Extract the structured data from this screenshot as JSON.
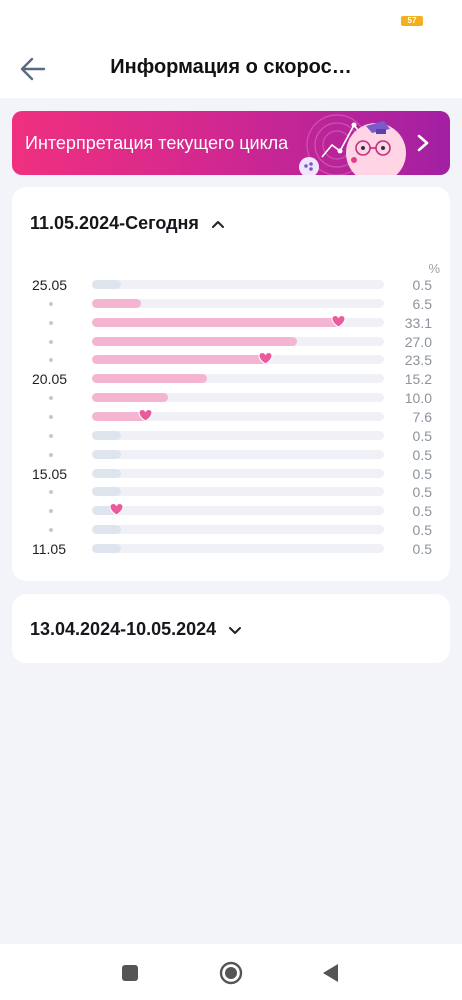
{
  "status_bar": {
    "battery": "57"
  },
  "header": {
    "title": "Информация о скорос…"
  },
  "banner": {
    "label": "Интерпретация текущего цикла"
  },
  "current_range": {
    "label": "11.05.2024-Сегодня",
    "unit": "%",
    "rows": [
      {
        "date": "25.05",
        "value": "0.5",
        "heart": false,
        "highlight": false
      },
      {
        "date": "",
        "value": "6.5",
        "heart": false,
        "highlight": true
      },
      {
        "date": "",
        "value": "33.1",
        "heart": true,
        "highlight": true
      },
      {
        "date": "",
        "value": "27.0",
        "heart": false,
        "highlight": true
      },
      {
        "date": "",
        "value": "23.5",
        "heart": true,
        "highlight": true
      },
      {
        "date": "20.05",
        "value": "15.2",
        "heart": false,
        "highlight": true
      },
      {
        "date": "",
        "value": "10.0",
        "heart": false,
        "highlight": true
      },
      {
        "date": "",
        "value": "7.6",
        "heart": true,
        "highlight": true
      },
      {
        "date": "",
        "value": "0.5",
        "heart": false,
        "highlight": false
      },
      {
        "date": "",
        "value": "0.5",
        "heart": false,
        "highlight": false
      },
      {
        "date": "15.05",
        "value": "0.5",
        "heart": false,
        "highlight": false
      },
      {
        "date": "",
        "value": "0.5",
        "heart": false,
        "highlight": false
      },
      {
        "date": "",
        "value": "0.5",
        "heart": true,
        "highlight": false
      },
      {
        "date": "",
        "value": "0.5",
        "heart": false,
        "highlight": false
      },
      {
        "date": "11.05",
        "value": "0.5",
        "heart": false,
        "highlight": false
      }
    ],
    "max_value": 38.5
  },
  "previous_range": {
    "label": "13.04.2024-10.05.2024"
  },
  "colors": {
    "pink_fill": "#f3b5d2",
    "grey_fill": "#dfe5ef",
    "heart": "#ea5a9c"
  }
}
